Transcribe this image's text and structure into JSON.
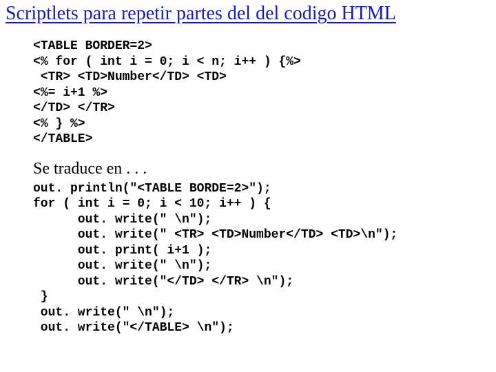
{
  "title": "Scriptlets para repetir partes del del codigo HTML",
  "code1": "<TABLE BORDER=2>\n<% for ( int i = 0; i < n; i++ ) {%>\n <TR> <TD>Number</TD> <TD>\n<%= i+1 %>\n</TD> </TR>\n<% } %>\n</TABLE>",
  "subheading": "Se traduce en . . .",
  "code2": "out. println(\"<TABLE BORDE=2>\");\nfor ( int i = 0; i < 10; i++ ) {\n      out. write(\" \\n\");\n      out. write(\" <TR> <TD>Number</TD> <TD>\\n\");\n      out. print( i+1 );\n      out. write(\" \\n\");\n      out. write(\"</TD> </TR> \\n\");\n }\n out. write(\" \\n\");\n out. write(\"</TABLE> \\n\");"
}
